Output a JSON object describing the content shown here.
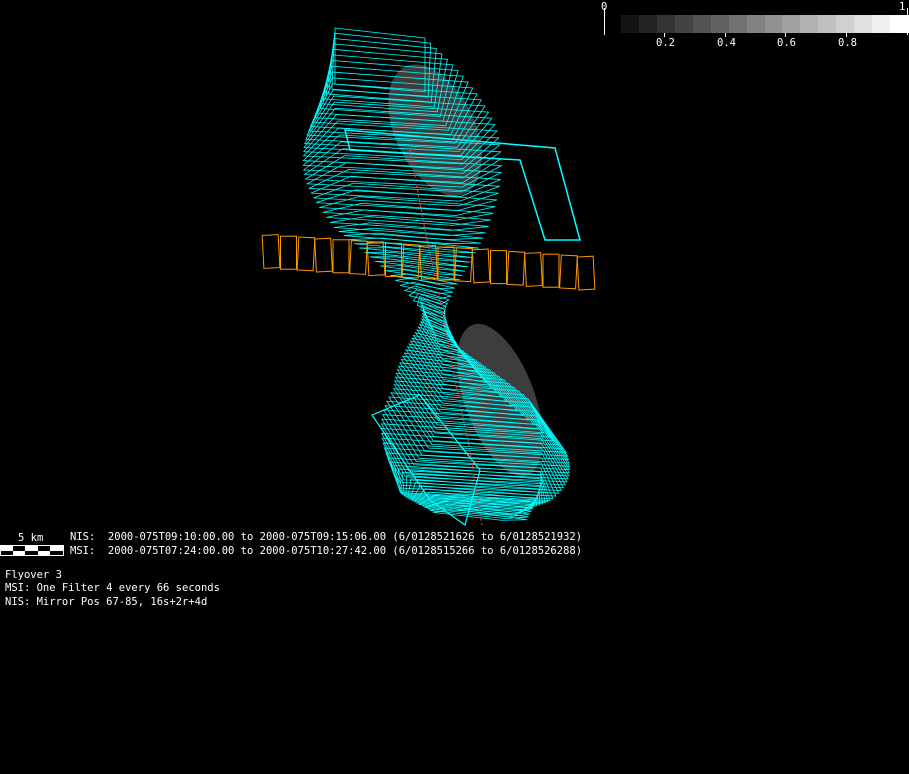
{
  "colorbar": {
    "min_label": "0",
    "max_label": "1",
    "ticks": [
      "0.2",
      "0.4",
      "0.6",
      "0.8"
    ],
    "steps": 16
  },
  "scale_bar": {
    "label": "5 km"
  },
  "timing": {
    "nis": "NIS:  2000-075T09:10:00.00 to 2000-075T09:15:06.00 (6/0128521626 to 6/0128521932)",
    "msi": "MSI:  2000-075T07:24:00.00 to 2000-075T10:27:42.00 (6/0128515266 to 6/0128526288)"
  },
  "info": {
    "title": "Flyover 3",
    "msi": "MSI: One Filter 4 every 66 seconds",
    "nis": "NIS: Mirror Pos 67-85, 16s+2r+4d"
  },
  "colors": {
    "footprint": "#00ffff",
    "nis_slit": "#ff9900",
    "track": "#ff3333"
  }
}
